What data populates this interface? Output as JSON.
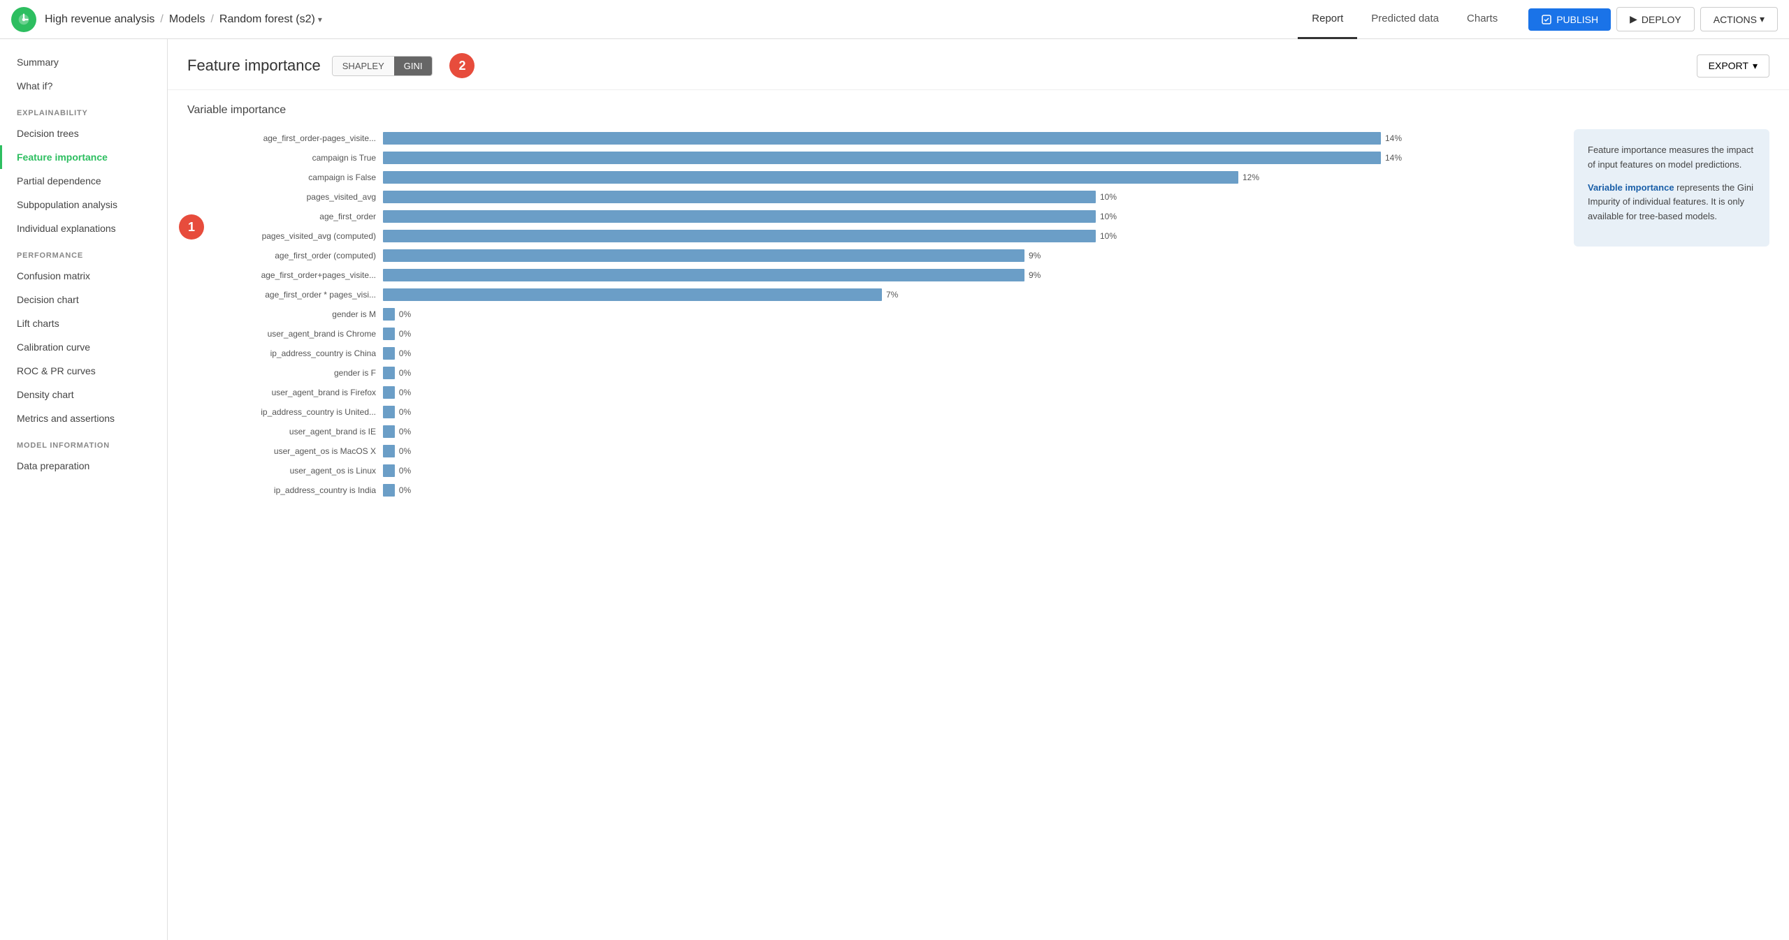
{
  "header": {
    "breadcrumb": {
      "part1": "High revenue analysis",
      "sep1": "/",
      "part2": "Models",
      "sep2": "/",
      "part3": "Random forest (s2)"
    },
    "nav": {
      "report": "Report",
      "predicted_data": "Predicted data",
      "charts": "Charts"
    },
    "buttons": {
      "publish": "PUBLISH",
      "deploy": "DEPLOY",
      "actions": "ACTIONS"
    }
  },
  "sidebar": {
    "top_items": [
      {
        "id": "summary",
        "label": "Summary"
      },
      {
        "id": "what_if",
        "label": "What if?"
      }
    ],
    "explainability_label": "EXPLAINABILITY",
    "explainability_items": [
      {
        "id": "decision_trees",
        "label": "Decision trees"
      },
      {
        "id": "feature_importance",
        "label": "Feature importance",
        "active": true
      },
      {
        "id": "partial_dependence",
        "label": "Partial dependence"
      },
      {
        "id": "subpopulation_analysis",
        "label": "Subpopulation analysis"
      },
      {
        "id": "individual_explanations",
        "label": "Individual explanations"
      }
    ],
    "performance_label": "PERFORMANCE",
    "performance_items": [
      {
        "id": "confusion_matrix",
        "label": "Confusion matrix"
      },
      {
        "id": "decision_chart",
        "label": "Decision chart"
      },
      {
        "id": "lift_charts",
        "label": "Lift charts"
      },
      {
        "id": "calibration_curve",
        "label": "Calibration curve"
      },
      {
        "id": "roc_pr_curves",
        "label": "ROC & PR curves"
      },
      {
        "id": "density_chart",
        "label": "Density chart"
      },
      {
        "id": "metrics_assertions",
        "label": "Metrics and assertions"
      }
    ],
    "model_info_label": "MODEL INFORMATION",
    "model_info_items": [
      {
        "id": "data_preparation",
        "label": "Data preparation"
      }
    ]
  },
  "feature_importance": {
    "title": "Feature importance",
    "btn_shapley": "SHAPLEY",
    "btn_gini": "GINI",
    "active_btn": "gini",
    "badge_number": "2",
    "export_label": "EXPORT",
    "chart_title": "Variable importance",
    "bars": [
      {
        "label": "age_first_order-pages_visite...",
        "pct": 14,
        "display": "14%"
      },
      {
        "label": "campaign is True",
        "pct": 14,
        "display": "14%"
      },
      {
        "label": "campaign is False",
        "pct": 12,
        "display": "12%"
      },
      {
        "label": "pages_visited_avg",
        "pct": 10,
        "display": "10%"
      },
      {
        "label": "age_first_order",
        "pct": 10,
        "display": "10%"
      },
      {
        "label": "pages_visited_avg (computed)",
        "pct": 10,
        "display": "10%"
      },
      {
        "label": "age_first_order (computed)",
        "pct": 9,
        "display": "9%"
      },
      {
        "label": "age_first_order+pages_visite...",
        "pct": 9,
        "display": "9%"
      },
      {
        "label": "age_first_order * pages_visi...",
        "pct": 7,
        "display": "7%"
      },
      {
        "label": "gender is M",
        "pct": 0,
        "display": "0%"
      },
      {
        "label": "user_agent_brand is Chrome",
        "pct": 0,
        "display": "0%"
      },
      {
        "label": "ip_address_country is China",
        "pct": 0,
        "display": "0%"
      },
      {
        "label": "gender is F",
        "pct": 0,
        "display": "0%"
      },
      {
        "label": "user_agent_brand is Firefox",
        "pct": 0,
        "display": "0%"
      },
      {
        "label": "ip_address_country is United...",
        "pct": 0,
        "display": "0%"
      },
      {
        "label": "user_agent_brand is IE",
        "pct": 0,
        "display": "0%"
      },
      {
        "label": "user_agent_os is MacOS X",
        "pct": 0,
        "display": "0%"
      },
      {
        "label": "user_agent_os is Linux",
        "pct": 0,
        "display": "0%"
      },
      {
        "label": "ip_address_country is India",
        "pct": 0,
        "display": "0%"
      }
    ],
    "info_panel": {
      "text1": "Feature importance measures the impact of input features on model predictions.",
      "text2_bold": "Variable importance",
      "text2_rest": " represents the Gini Impurity of individual features. It is only available for tree-based models."
    },
    "badge1_label": "1",
    "badge2_label": "2"
  }
}
